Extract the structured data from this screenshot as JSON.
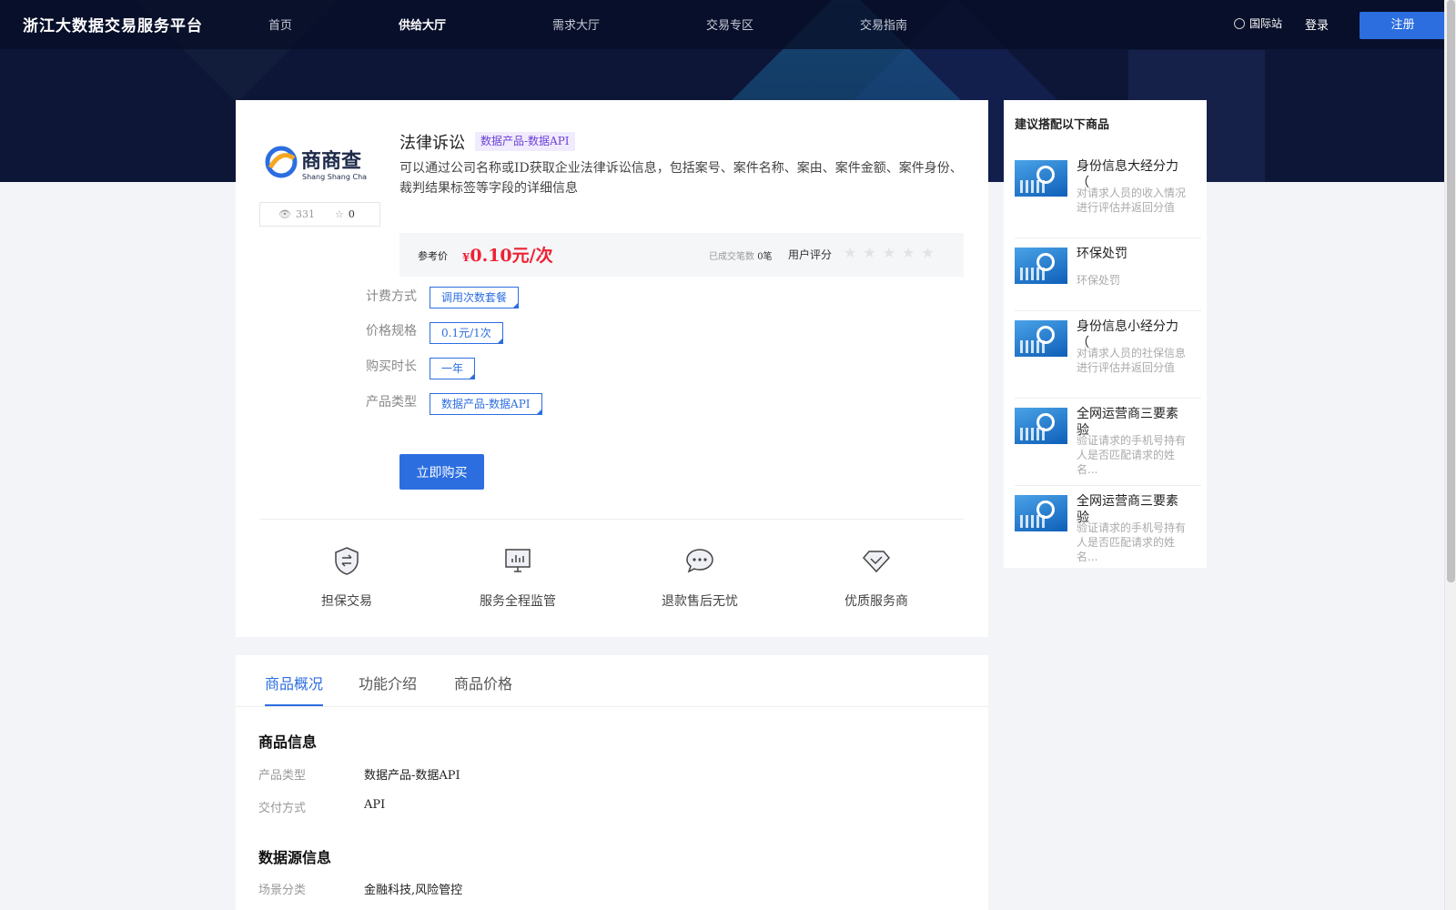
{
  "header": {
    "logo": "浙江大数据交易服务平台",
    "nav": [
      "首页",
      "供给大厅",
      "需求大厅",
      "交易专区",
      "交易指南"
    ],
    "active_nav": "供给大厅",
    "international": "国际站",
    "login": "登录",
    "register": "注册"
  },
  "product": {
    "logo_text": "商商查",
    "logo_subtext": "Shang Shang Cha",
    "views": "331",
    "favorites": "0",
    "title": "法律诉讼",
    "tag": "数据产品-数据API",
    "description": "可以通过公司名称或ID获取企业法律诉讼信息，包括案号、案件名称、案由、案件金额、案件身份、裁判结果标签等字段的详细信息",
    "price_label": "参考价",
    "price_currency": "¥",
    "price_value": "0.10元/次",
    "deals_label": "已成交笔数",
    "deals_value": "0笔",
    "rating_label": "用户评分",
    "rating": 0,
    "options": [
      {
        "label": "计费方式",
        "value": "调用次数套餐"
      },
      {
        "label": "价格规格",
        "value": "0.1元/1次"
      },
      {
        "label": "购买时长",
        "value": "一年"
      },
      {
        "label": "产品类型",
        "value": "数据产品-数据API"
      }
    ],
    "buy_button": "立即购买",
    "features": [
      "担保交易",
      "服务全程监管",
      "退款售后无忧",
      "优质服务商"
    ]
  },
  "recommend": {
    "title": "建议搭配以下商品",
    "items": [
      {
        "name": "身份信息大经分力（",
        "sub": "对请求人员的收入情况进行评估并返回分值"
      },
      {
        "name": "环保处罚",
        "sub": "环保处罚"
      },
      {
        "name": "身份信息小经分力（",
        "sub": "对请求人员的社保信息进行评估并返回分值"
      },
      {
        "name": "全网运营商三要素验",
        "sub": "验证请求的手机号持有人是否匹配请求的姓名..."
      },
      {
        "name": "全网运营商三要素验",
        "sub": "验证请求的手机号持有人是否匹配请求的姓名..."
      }
    ]
  },
  "tabs": {
    "items": [
      "商品概况",
      "功能介绍",
      "商品价格"
    ],
    "active": "商品概况"
  },
  "info": {
    "title": "商品信息",
    "rows": [
      {
        "key": "产品类型",
        "value": "数据产品-数据API"
      },
      {
        "key": "交付方式",
        "value": "API"
      }
    ]
  },
  "source": {
    "title": "数据源信息",
    "rows": [
      {
        "key": "场景分类",
        "value": "金融科技,风险管控"
      }
    ]
  },
  "colors": {
    "accent": "#2c6ee0",
    "price": "#ee2233",
    "header_bg": "#0d1637"
  }
}
